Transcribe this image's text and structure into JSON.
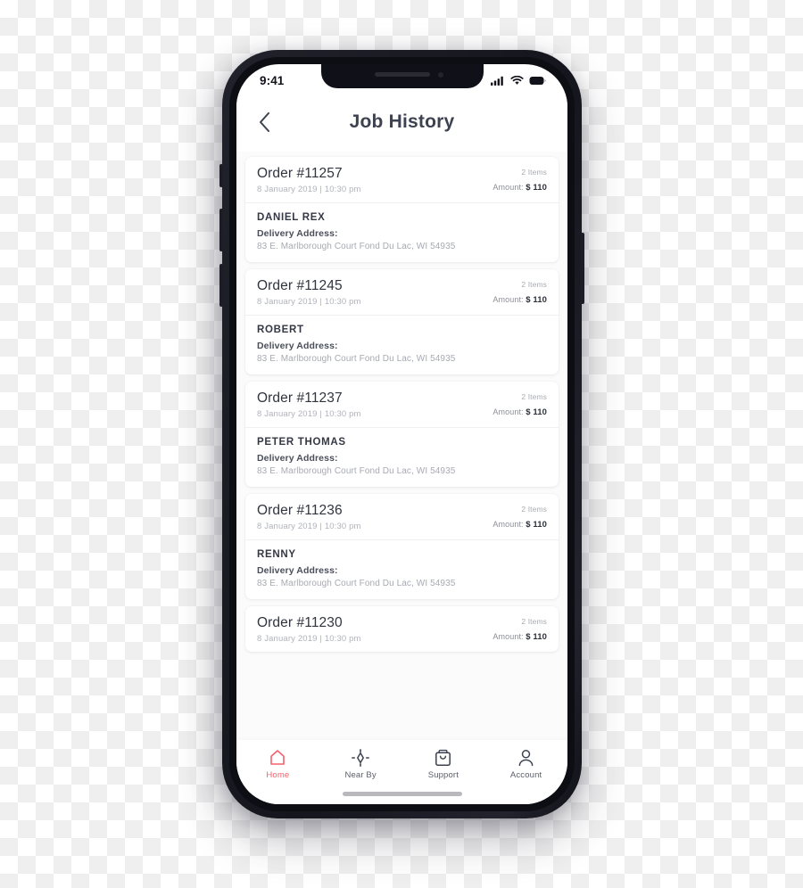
{
  "device": {
    "status_bar": {
      "time": "9:41",
      "icons": [
        "signal-icon",
        "wifi-icon",
        "battery-icon"
      ]
    },
    "home_indicator": "home-indicator"
  },
  "navbar": {
    "back_icon": "chevron-left-icon",
    "title": "Job History"
  },
  "labels": {
    "delivery_address": "Delivery Address:",
    "amount_prefix": "Amount:"
  },
  "orders": [
    {
      "order_id": "Order #11257",
      "date": "8 January 2019",
      "separator": "|",
      "time": "10:30 pm",
      "items": "2 Items",
      "amount_label": "Amount:",
      "amount_value": "$ 110",
      "customer": "DANIEL REX",
      "address_label": "Delivery Address:",
      "address": "83 E. Marlborough Court Fond Du Lac, WI 54935",
      "has_details": true
    },
    {
      "order_id": "Order #11245",
      "date": "8 January 2019",
      "separator": "|",
      "time": "10:30 pm",
      "items": "2 Items",
      "amount_label": "Amount:",
      "amount_value": "$ 110",
      "customer": "ROBERT",
      "address_label": "Delivery Address:",
      "address": "83 E. Marlborough Court Fond Du Lac, WI 54935",
      "has_details": true
    },
    {
      "order_id": "Order #11237",
      "date": "8 January 2019",
      "separator": "|",
      "time": "10:30 pm",
      "items": "2 Items",
      "amount_label": "Amount:",
      "amount_value": "$ 110",
      "customer": "PETER THOMAS",
      "address_label": "Delivery Address:",
      "address": "83 E. Marlborough Court Fond Du Lac, WI 54935",
      "has_details": true
    },
    {
      "order_id": "Order #11236",
      "date": "8 January 2019",
      "separator": "|",
      "time": "10:30 pm",
      "items": "2 Items",
      "amount_label": "Amount:",
      "amount_value": "$ 110",
      "customer": "RENNY",
      "address_label": "Delivery Address:",
      "address": "83 E. Marlborough Court Fond Du Lac, WI 54935",
      "has_details": true
    },
    {
      "order_id": "Order #11230",
      "date": "8 January 2019",
      "separator": "|",
      "time": "10:30 pm",
      "items": "2 Items",
      "amount_label": "Amount:",
      "amount_value": "$ 110",
      "customer": "",
      "address_label": "",
      "address": "",
      "has_details": false
    }
  ],
  "tabbar": {
    "active_index": 0,
    "active_color": "#f4606a",
    "inactive_color": "#5a5e69",
    "tabs": [
      {
        "label": "Home",
        "icon": "home-icon"
      },
      {
        "label": "Near By",
        "icon": "crosshair-icon"
      },
      {
        "label": "Support",
        "icon": "shopping-bag-icon"
      },
      {
        "label": "Account",
        "icon": "person-icon"
      }
    ]
  }
}
